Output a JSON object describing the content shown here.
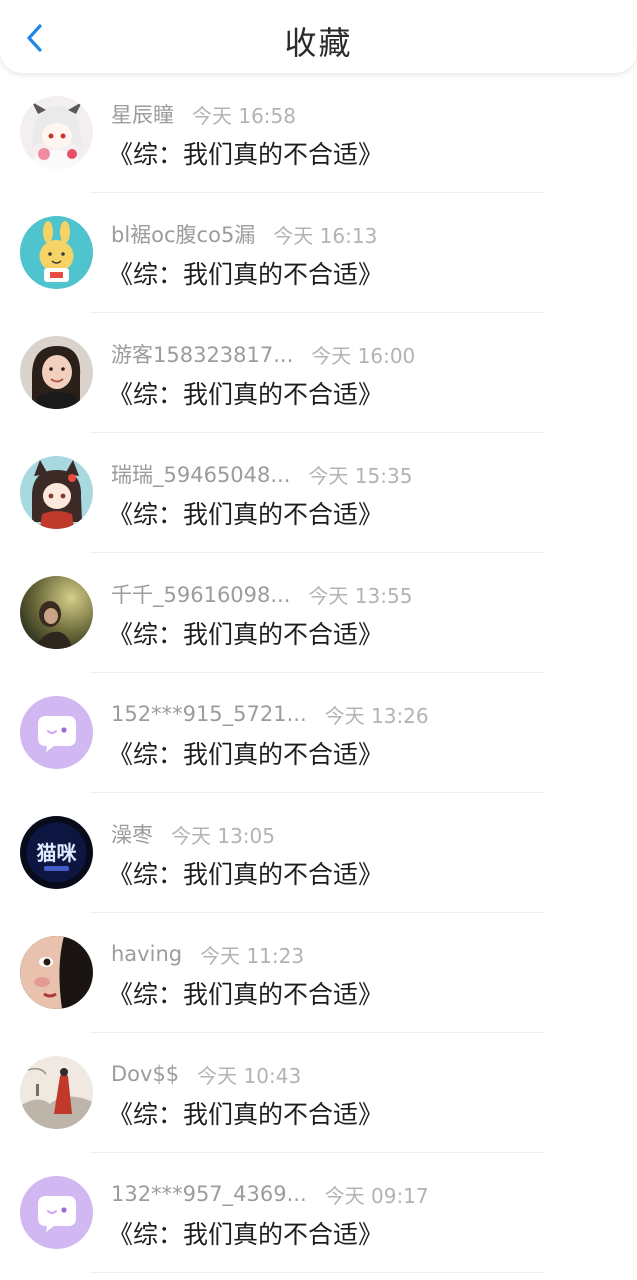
{
  "header": {
    "title": "收藏",
    "back_icon": "chevron-left-icon",
    "accent_color": "#1e88e5"
  },
  "items": [
    {
      "username": "星辰瞳",
      "time": "今天 16:58",
      "book": "《综：我们真的不合适》",
      "avatar": "anime-girl-avatar"
    },
    {
      "username": "bl裾oc腹co5漏",
      "time": "今天 16:13",
      "book": "《综：我们真的不合适》",
      "avatar": "cartoon-rabbit-avatar"
    },
    {
      "username": "游客158323817...",
      "time": "今天 16:00",
      "book": "《综：我们真的不合适》",
      "avatar": "child-photo-avatar"
    },
    {
      "username": "瑞瑞_59465048...",
      "time": "今天 15:35",
      "book": "《综：我们真的不合适》",
      "avatar": "anime-fox-girl-avatar"
    },
    {
      "username": "千千_59616098...",
      "time": "今天 13:55",
      "book": "《综：我们真的不合适》",
      "avatar": "outdoor-photo-avatar"
    },
    {
      "username": "152***915_5721...",
      "time": "今天 13:26",
      "book": "《综：我们真的不合适》",
      "avatar": "default-chat-avatar"
    },
    {
      "username": "澡枣",
      "time": "今天 13:05",
      "book": "《综：我们真的不合适》",
      "avatar": "cat-text-avatar"
    },
    {
      "username": "having",
      "time": "今天 11:23",
      "book": "《综：我们真的不合适》",
      "avatar": "painted-face-avatar"
    },
    {
      "username": "Dov$$",
      "time": "今天 10:43",
      "book": "《综：我们真的不合适》",
      "avatar": "ink-painting-avatar"
    },
    {
      "username": "132***957_4369...",
      "time": "今天 09:17",
      "book": "《综：我们真的不合适》",
      "avatar": "default-chat-avatar"
    }
  ],
  "avatar_text": {
    "cat_text": "猫咪"
  }
}
